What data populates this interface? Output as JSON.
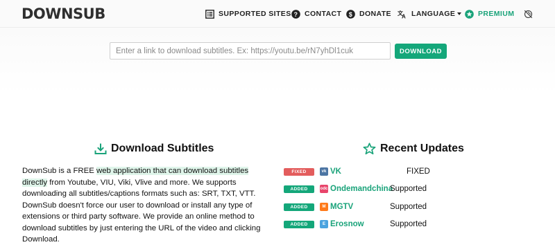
{
  "header": {
    "logo_text": "DOWNSUB",
    "nav": {
      "supported_sites": "SUPPORTED SITES",
      "contact": "CONTACT",
      "donate": "DONATE",
      "language": "LANGUAGE",
      "premium": "PREMIUM"
    }
  },
  "search": {
    "placeholder": "Enter a link to download subtitles. Ex: https://youtu.be/rN7yhDl1cuk",
    "value": "",
    "button_label": "DOWNLOAD"
  },
  "download_section": {
    "title": "Download Subtitles",
    "para1_before": "DownSub is a FREE ",
    "para1_highlight": "web application that can download subtitles directly",
    "para1_after": " from Youtube, VIU, Viki, Vlive and more. We supports downloading all subtitles/captions formats such as: SRT, TXT, VTT.",
    "para2": "DownSub doesn't force our user to download or install any type of extensions or third party software. We provide an online method to download subtitles by just entering the URL of the video and clicking Download."
  },
  "updates_section": {
    "title": "Recent Updates",
    "items": [
      {
        "badge": "FIXED",
        "badge_type": "fixed",
        "site": "VK",
        "status": "FIXED",
        "icon": "vk-icon",
        "icon_color": "#4c75a3",
        "icon_glyph": "vk"
      },
      {
        "badge": "ADDED",
        "badge_type": "added",
        "site": "Ondemandchina",
        "status": "Supported",
        "icon": "ondemandchina-icon",
        "icon_color": "#e8456b",
        "icon_glyph": "odc"
      },
      {
        "badge": "ADDED",
        "badge_type": "added",
        "site": "MGTV",
        "status": "Supported",
        "icon": "mgtv-icon",
        "icon_color": "#ff7a1a",
        "icon_glyph": "M"
      },
      {
        "badge": "ADDED",
        "badge_type": "added",
        "site": "Erosnow",
        "status": "Supported",
        "icon": "erosnow-icon",
        "icon_color": "#4aa3df",
        "icon_glyph": "E"
      }
    ]
  },
  "colors": {
    "accent": "#14a77a",
    "fixed": "#e35d5d",
    "highlight": "#dff5ea"
  }
}
